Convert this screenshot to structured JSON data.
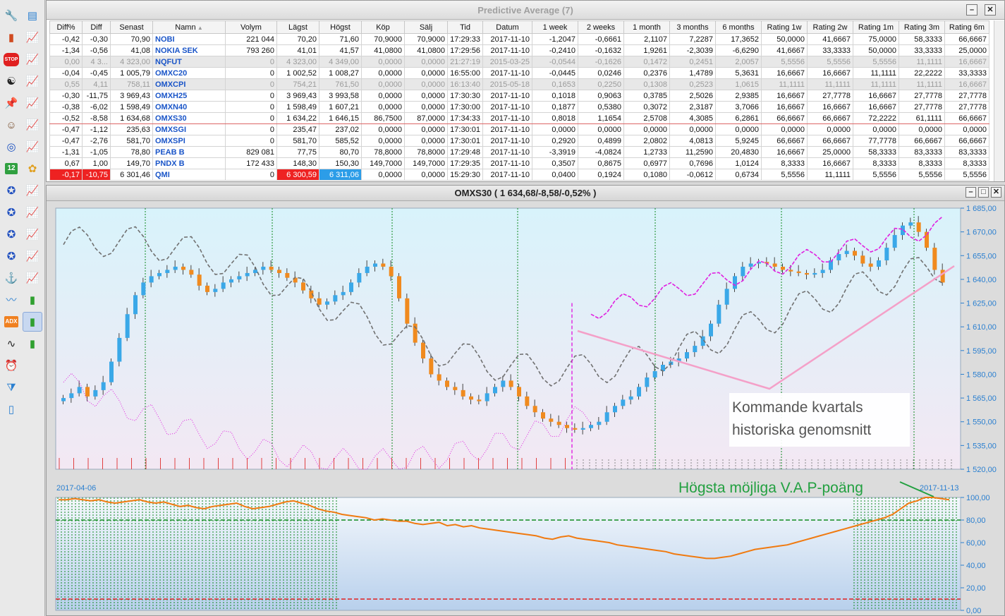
{
  "toolbar": {
    "icons": [
      "wrench-icon",
      "notepad-icon",
      "bar-chart-icon",
      "chart-v-icon",
      "stop-icon",
      "chart-v2-icon",
      "yinyang-icon",
      "chart-1-icon",
      "pin-icon",
      "chart-2-icon",
      "portrait-icon",
      "chart-b-icon",
      "swirl-icon",
      "chart-f-icon",
      "calendar-icon",
      "colors-icon",
      "compass-icon",
      "chart-m-icon",
      "compass-n-icon",
      "chart-r-icon",
      "compass-w-icon",
      "chart-o-icon",
      "compass-s-icon",
      "chart-s-icon",
      "anchor-icon",
      "chart-d-icon",
      "trend-icon",
      "bars-green-icon",
      "adx-icon",
      "bars-selected-icon",
      "wave-icon",
      "bars-green2-icon",
      "alarm-icon",
      "filter-icon",
      "blank-page-icon"
    ],
    "calendar_day": "12",
    "adx_label": "ADX",
    "stop_label": "STOP"
  },
  "table_window": {
    "title": "Predictive Average (7)",
    "columns": [
      "Diff%",
      "Diff",
      "Senast",
      "Namn",
      "Volym",
      "Lägst",
      "Högst",
      "Köp",
      "Sälj",
      "Tid",
      "Datum",
      "1 week",
      "2 weeks",
      "1 month",
      "3 months",
      "6 months",
      "Rating 1w",
      "Rating 2w",
      "Rating 1m",
      "Rating 3m",
      "Rating 6m"
    ],
    "rows": [
      {
        "cells": [
          "-0,42",
          "-0,30",
          "70,90",
          "NOBI",
          "221 044",
          "70,20",
          "71,60",
          "70,9000",
          "70,9000",
          "17:29:33",
          "2017-11-10",
          "-1,2047",
          "-0,6661",
          "2,1107",
          "7,2287",
          "17,3652",
          "50,0000",
          "41,6667",
          "75,0000",
          "58,3333",
          "66,6667"
        ],
        "state": "normal"
      },
      {
        "cells": [
          "-1,34",
          "-0,56",
          "41,08",
          "NOKIA SEK",
          "793 260",
          "41,01",
          "41,57",
          "41,0800",
          "41,0800",
          "17:29:56",
          "2017-11-10",
          "-0,2410",
          "-0,1632",
          "1,9261",
          "-2,3039",
          "-6,6290",
          "41,6667",
          "33,3333",
          "50,0000",
          "33,3333",
          "25,0000"
        ],
        "state": "normal"
      },
      {
        "cells": [
          "0,00",
          "4 3...",
          "4 323,00",
          "NQFUT",
          "0",
          "4 323,00",
          "4 349,00",
          "0,0000",
          "0,0000",
          "21:27:19",
          "2015-03-25",
          "-0,0544",
          "-0,1626",
          "0,1472",
          "0,2451",
          "2,0057",
          "5,5556",
          "5,5556",
          "5,5556",
          "11,1111",
          "16,6667"
        ],
        "state": "grey"
      },
      {
        "cells": [
          "-0,04",
          "-0,45",
          "1 005,79",
          "OMXC20",
          "0",
          "1 002,52",
          "1 008,27",
          "0,0000",
          "0,0000",
          "16:55:00",
          "2017-11-10",
          "-0,0445",
          "0,0246",
          "0,2376",
          "1,4789",
          "5,3631",
          "16,6667",
          "16,6667",
          "11,1111",
          "22,2222",
          "33,3333"
        ],
        "state": "normal"
      },
      {
        "cells": [
          "0,55",
          "4,11",
          "758,11",
          "OMXCPI",
          "0",
          "754,21",
          "761,50",
          "0,0000",
          "0,0000",
          "16:13:40",
          "2015-05-18",
          "0,1653",
          "0,2250",
          "0,1308",
          "0,2523",
          "1,0615",
          "11,1111",
          "11,1111",
          "11,1111",
          "11,1111",
          "16,6667"
        ],
        "state": "grey"
      },
      {
        "cells": [
          "-0,30",
          "-11,75",
          "3 969,43",
          "OMXH25",
          "0",
          "3 969,43",
          "3 993,58",
          "0,0000",
          "0,0000",
          "17:30:30",
          "2017-11-10",
          "0,1018",
          "0,9063",
          "0,3785",
          "2,5026",
          "2,9385",
          "16,6667",
          "27,7778",
          "16,6667",
          "27,7778",
          "27,7778"
        ],
        "state": "normal"
      },
      {
        "cells": [
          "-0,38",
          "-6,02",
          "1 598,49",
          "OMXN40",
          "0",
          "1 598,49",
          "1 607,21",
          "0,0000",
          "0,0000",
          "17:30:00",
          "2017-11-10",
          "0,1877",
          "0,5380",
          "0,3072",
          "2,3187",
          "3,7066",
          "16,6667",
          "16,6667",
          "16,6667",
          "27,7778",
          "27,7778"
        ],
        "state": "normal"
      },
      {
        "cells": [
          "-0,52",
          "-8,58",
          "1 634,68",
          "OMXS30",
          "0",
          "1 634,22",
          "1 646,15",
          "86,7500",
          "87,0000",
          "17:34:33",
          "2017-11-10",
          "0,8018",
          "1,1654",
          "2,5708",
          "4,3085",
          "6,2861",
          "66,6667",
          "66,6667",
          "72,2222",
          "61,1111",
          "66,6667"
        ],
        "state": "sel"
      },
      {
        "cells": [
          "-0,47",
          "-1,12",
          "235,63",
          "OMXSGI",
          "0",
          "235,47",
          "237,02",
          "0,0000",
          "0,0000",
          "17:30:01",
          "2017-11-10",
          "0,0000",
          "0,0000",
          "0,0000",
          "0,0000",
          "0,0000",
          "0,0000",
          "0,0000",
          "0,0000",
          "0,0000",
          "0,0000"
        ],
        "state": "normal"
      },
      {
        "cells": [
          "-0,47",
          "-2,76",
          "581,70",
          "OMXSPI",
          "0",
          "581,70",
          "585,52",
          "0,0000",
          "0,0000",
          "17:30:01",
          "2017-11-10",
          "0,2920",
          "0,4899",
          "2,0802",
          "4,0813",
          "5,9245",
          "66,6667",
          "66,6667",
          "77,7778",
          "66,6667",
          "66,6667"
        ],
        "state": "normal"
      },
      {
        "cells": [
          "-1,31",
          "-1,05",
          "78,80",
          "PEAB B",
          "829 081",
          "77,75",
          "80,70",
          "78,8000",
          "78,8000",
          "17:29:48",
          "2017-11-10",
          "-3,3919",
          "-4,0824",
          "1,2733",
          "11,2590",
          "20,4830",
          "16,6667",
          "25,0000",
          "58,3333",
          "83,3333",
          "83,3333"
        ],
        "state": "normal"
      },
      {
        "cells": [
          "0,67",
          "1,00",
          "149,70",
          "PNDX B",
          "172 433",
          "148,30",
          "150,30",
          "149,7000",
          "149,7000",
          "17:29:35",
          "2017-11-10",
          "0,3507",
          "0,8675",
          "0,6977",
          "0,7696",
          "1,0124",
          "8,3333",
          "16,6667",
          "8,3333",
          "8,3333",
          "8,3333"
        ],
        "state": "normal"
      },
      {
        "cells": [
          "-0,17",
          "-10,75",
          "6 301,46",
          "QMI",
          "0",
          "6 300,59",
          "6 311,06",
          "0,0000",
          "0,0000",
          "15:29:30",
          "2017-11-10",
          "0,0400",
          "0,1924",
          "0,1080",
          "-0,0612",
          "0,6734",
          "5,5556",
          "11,1111",
          "5,5556",
          "5,5556",
          "5,5556"
        ],
        "state": "qmi"
      }
    ]
  },
  "chart_window": {
    "title": "OMXS30 ( 1 634,68/-8,58/-0,52% )",
    "annotation_text_line1": "Kommande kvartals",
    "annotation_text_line2": "historiska genomsnitt",
    "annotation_green": "Högsta möjliga V.A.P-poäng",
    "date_start": "2017-04-06",
    "date_end": "2017-11-13",
    "price_ticks": [
      "1 685,00",
      "1 670,00",
      "1 655,00",
      "1 640,00",
      "1 625,00",
      "1 610,00",
      "1 595,00",
      "1 580,00",
      "1 565,00",
      "1 550,00",
      "1 535,00",
      "1 520,00"
    ],
    "score_ticks": [
      "100,00",
      "80,00",
      "60,00",
      "40,00",
      "20,00",
      "0,00"
    ],
    "colors": {
      "up": "#3aa8e8",
      "down": "#f08a1e",
      "magenta": "#e020e0",
      "grey": "#707070",
      "pink": "#f4a0c8",
      "orange": "#f07a10",
      "green": "#22a040"
    }
  },
  "chart_data": [
    {
      "type": "line",
      "title": "OMXS30 ( 1 634,68/-8,58/-0,52% )",
      "x_range": [
        "2017-04-06",
        "2017-11-13"
      ],
      "ylim": [
        1520,
        1685
      ],
      "series": [
        {
          "values": [
            1565,
            1568,
            1572,
            1566,
            1570,
            1575,
            1588,
            1603,
            1618,
            1630,
            1638,
            1642,
            1644,
            1646,
            1648,
            1646,
            1643,
            1636,
            1632,
            1634,
            1638,
            1640,
            1642,
            1644,
            1646,
            1648,
            1646,
            1644,
            1641,
            1638,
            1633,
            1628,
            1624,
            1626,
            1630,
            1632,
            1638,
            1644,
            1648,
            1650,
            1648,
            1642,
            1628,
            1612,
            1600,
            1590,
            1580,
            1576,
            1572,
            1570,
            1566,
            1564,
            1563,
            1568,
            1572,
            1576,
            1572,
            1566,
            1560,
            1556,
            1552,
            1550,
            1548,
            1546,
            1545,
            1546,
            1548,
            1550,
            1556,
            1560,
            1564,
            1566,
            1572,
            1578,
            1582,
            1586,
            1588,
            1590,
            1594,
            1598,
            1604,
            1612,
            1624,
            1634,
            1642,
            1648,
            1650,
            1651,
            1650,
            1648,
            1646,
            1645,
            1644,
            1643,
            1644,
            1646,
            1652,
            1656,
            1658,
            1655,
            1650,
            1648,
            1652,
            1660,
            1668,
            1674,
            1676,
            1670,
            1660,
            1646,
            1638
          ]
        }
      ]
    },
    {
      "type": "line",
      "ylim": [
        0,
        100
      ],
      "series": [
        {
          "values": [
            98,
            98,
            99,
            98,
            97,
            98,
            96,
            95,
            96,
            97,
            98,
            96,
            95,
            96,
            94,
            92,
            93,
            91,
            90,
            92,
            93,
            94,
            95,
            92,
            90,
            91,
            92,
            94,
            96,
            97,
            95,
            93,
            90,
            88,
            87,
            85,
            84,
            83,
            82,
            80,
            81,
            80,
            79,
            79,
            77,
            76,
            77,
            78,
            75,
            76,
            74,
            75,
            73,
            72,
            71,
            70,
            69,
            68,
            67,
            66,
            64,
            63,
            65,
            66,
            64,
            63,
            62,
            61,
            60,
            58,
            57,
            56,
            55,
            54,
            53,
            52,
            50,
            49,
            48,
            47,
            46,
            46,
            47,
            48,
            50,
            52,
            54,
            55,
            56,
            57,
            58,
            60,
            62,
            64,
            66,
            68,
            70,
            72,
            74,
            76,
            78,
            80,
            82,
            85,
            90,
            95,
            97,
            100,
            100,
            99,
            98
          ]
        }
      ]
    }
  ]
}
